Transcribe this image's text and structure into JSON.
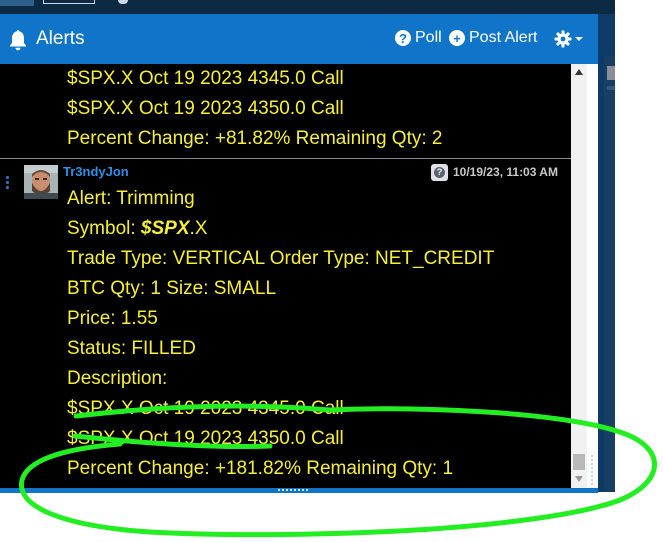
{
  "header": {
    "title": "Alerts",
    "poll_label": "Poll",
    "post_alert_label": "Post Alert"
  },
  "feed": {
    "prev_lines": [
      "$SPX.X Oct 19 2023 4345.0 Call",
      "$SPX.X Oct 19 2023 4350.0 Call",
      "Percent Change: +81.82% Remaining Qty: 2"
    ],
    "post": {
      "username": "Tr3ndyJon",
      "timestamp": "10/19/23, 11:03 AM",
      "alert": "Alert: Trimming",
      "symbol_prefix": "Symbol: ",
      "symbol_ticker": "$SPX",
      "symbol_suffix": ".X",
      "trade_type": "Trade Type: VERTICAL Order Type: NET_CREDIT",
      "btc": "BTC Qty: 1 Size: SMALL",
      "price": "Price: 1.55",
      "status": "Status: FILLED",
      "description": "Description:",
      "leg1": "$SPX.X Oct 19 2023 4345.0 Call",
      "leg2": "$SPX.X Oct 19 2023 4350.0 Call",
      "percent": "Percent Change: +181.82% Remaining Qty: 1"
    }
  },
  "colors": {
    "header_bg": "#1075c9",
    "feed_bg": "#000000",
    "alert_text": "#f7ef36",
    "username": "#2f8ee6",
    "annotation": "#22ee22"
  },
  "icons": [
    "bell-icon",
    "question-circle-icon",
    "plus-circle-icon",
    "gear-icon",
    "caret-down-icon",
    "kebab-menu-icon",
    "alert-info-icon"
  ]
}
